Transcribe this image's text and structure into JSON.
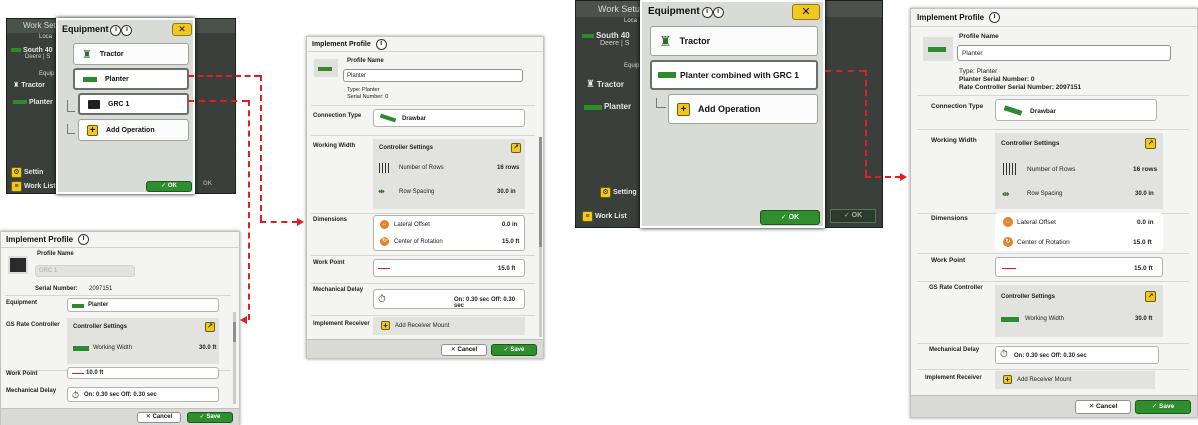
{
  "left_screen": {
    "bar_title": "Work Setu",
    "rows": [
      {
        "label": "South 40",
        "sub": "Deere | S"
      },
      {
        "label": "Tractor"
      },
      {
        "label": "Planter"
      }
    ],
    "section_labels": [
      "Loca",
      "Equip"
    ],
    "settings_label": "Settin",
    "work_list_label": "Work List",
    "ok_label": "OK"
  },
  "left_popup": {
    "title": "Equipment",
    "close_label": "✕",
    "items": [
      "Tractor",
      "Planter",
      "GRC 1",
      "Add Operation"
    ],
    "ok_label": "OK"
  },
  "grc_profile": {
    "title": "Implement Profile",
    "profile_name_label": "Profile Name",
    "profile_name_value": "GRC 1",
    "serial_label": "Serial Number:",
    "serial_value": "2097151",
    "equipment_label": "Equipment",
    "equipment_value": "Planter",
    "rate_controller_label": "GS Rate Controller",
    "controller_settings_label": "Controller Settings",
    "working_width_label": "Working Width",
    "working_width_value": "30.0 ft",
    "work_point_label": "Work Point",
    "work_point_value": "10.0 ft",
    "mech_delay_label": "Mechanical Delay",
    "mech_delay_value": "On: 0.30 sec Off: 0.30 sec",
    "cancel_label": "Cancel",
    "save_label": "Save"
  },
  "planter_profile": {
    "title": "Implement Profile",
    "profile_name_label": "Profile Name",
    "profile_name_value": "Planter",
    "type_line": "Type: Planter",
    "serial_line": "Serial Number: 0",
    "connection_type_label": "Connection Type",
    "connection_type_value": "Drawbar",
    "working_width_label": "Working Width",
    "controller_settings_label": "Controller Settings",
    "rows_label": "Number of Rows",
    "rows_value": "16 rows",
    "spacing_label": "Row Spacing",
    "spacing_value": "30.0 in",
    "dimensions_label": "Dimensions",
    "lateral_label": "Lateral Offset",
    "lateral_value": "0.0 in",
    "rotation_label": "Center of Rotation",
    "rotation_value": "15.0 ft",
    "work_point_label": "Work Point",
    "work_point_value": "15.0 ft",
    "mech_delay_label": "Mechanical Delay",
    "mech_delay_value": "On: 0.30 sec Off: 0.30 sec",
    "receiver_label": "Implement Receiver",
    "receiver_btn": "Add Receiver Mount",
    "cancel_label": "Cancel",
    "save_label": "Save"
  },
  "right_screen": {
    "bar_title": "Work Setu",
    "rows": [
      {
        "label": "South 40",
        "sub": "Deere | S"
      },
      {
        "label": "Tractor"
      },
      {
        "label": "Planter"
      }
    ],
    "section_labels": [
      "Loca",
      "Equip"
    ],
    "settings_label": "Setting",
    "work_list_label": "Work List",
    "ok_label": "OK"
  },
  "right_popup": {
    "title": "Equipment",
    "close_label": "✕",
    "items": [
      "Tractor",
      "Planter combined with GRC 1",
      "Add Operation"
    ],
    "ok_label": "OK"
  },
  "combined_profile": {
    "title": "Implement Profile",
    "profile_name_label": "Profile Name",
    "profile_name_value": "Planter",
    "type_line": "Type: Planter",
    "planter_serial_line": "Planter Serial Number: 0",
    "rate_serial_line": "Rate Controller Serial Number: 2097151",
    "connection_type_label": "Connection Type",
    "connection_type_value": "Drawbar",
    "working_width_label": "Working Width",
    "controller_settings_label": "Controller Settings",
    "rows_label": "Number of Rows",
    "rows_value": "16 rows",
    "spacing_label": "Row Spacing",
    "spacing_value": "30.0 in",
    "dimensions_label": "Dimensions",
    "lateral_label": "Lateral Offset",
    "lateral_value": "0.0 in",
    "rotation_label": "Center of Rotation",
    "rotation_value": "15.0 ft",
    "work_point_label": "Work Point",
    "work_point_value": "15.0 ft",
    "rate_controller_label": "GS Rate Controller",
    "controller_settings_label2": "Controller Settings",
    "ww_label": "Working Width",
    "ww_value": "30.0 ft",
    "mech_delay_label": "Mechanical Delay",
    "mech_delay_value": "On: 0.30 sec Off: 0.30 sec",
    "receiver_label": "Implement Receiver",
    "receiver_btn": "Add Receiver Mount",
    "cancel_label": "Cancel",
    "save_label": "Save"
  },
  "colors": {
    "accent_green": "#2f8f2f",
    "yellow": "#f2c81f",
    "arrow_red": "#e02020",
    "orange": "#e8812a"
  }
}
